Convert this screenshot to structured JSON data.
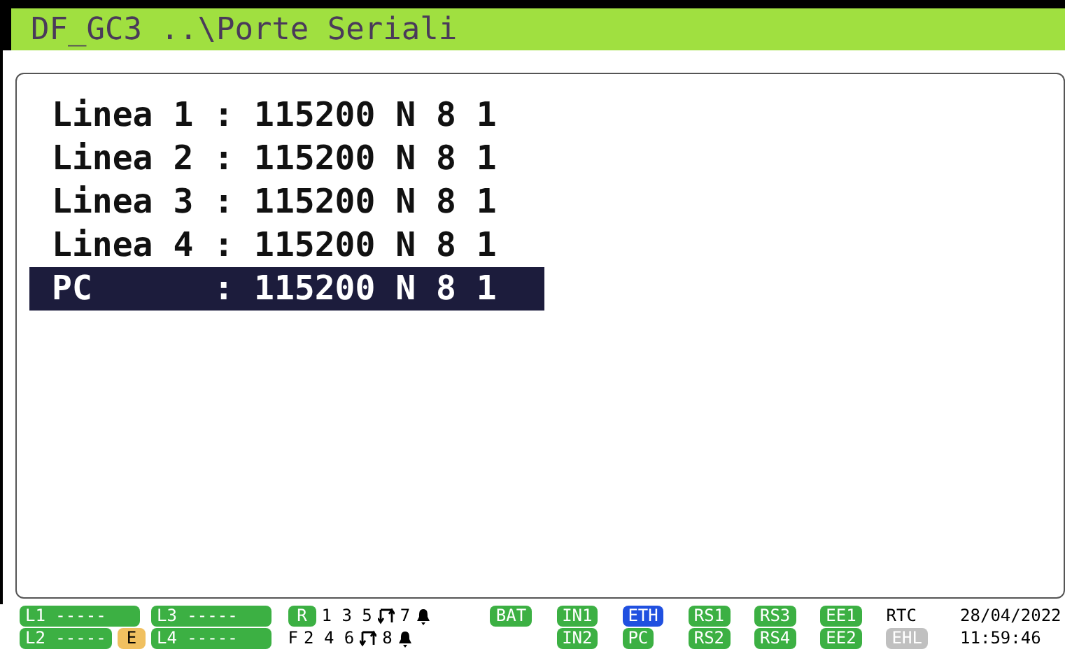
{
  "window": {
    "title": "DF_GC3 ..\\Porte Seriali"
  },
  "lines": [
    {
      "text": "Linea 1 : 115200 N 8 1",
      "selected": false
    },
    {
      "text": "Linea 2 : 115200 N 8 1",
      "selected": false
    },
    {
      "text": "Linea 3 : 115200 N 8 1",
      "selected": false
    },
    {
      "text": "Linea 4 : 115200 N 8 1",
      "selected": false
    },
    {
      "text": "PC      : 115200 N 8 1",
      "selected": true
    }
  ],
  "status_bar": {
    "columns": [
      {
        "rows": [
          [
            {
              "kind": "wide",
              "text": "L1 -----",
              "color": "#3cb043"
            }
          ],
          [
            {
              "kind": "wide",
              "text": "L2 -----",
              "color": "#3cb043"
            },
            {
              "kind": "badge",
              "text": "E",
              "color": "#f0c060"
            }
          ]
        ]
      },
      {
        "rows": [
          [
            {
              "kind": "wide",
              "text": "L3 -----",
              "color": "#3cb043"
            }
          ],
          [
            {
              "kind": "wide",
              "text": "L4 -----",
              "color": "#3cb043"
            }
          ]
        ]
      },
      {
        "rows": [
          [
            {
              "kind": "badge",
              "text": "R",
              "color": "#3cb043"
            },
            {
              "kind": "text",
              "text": "1 3 5"
            },
            {
              "kind": "swap"
            },
            {
              "kind": "text",
              "text": "7"
            },
            {
              "kind": "bell"
            }
          ],
          [
            {
              "kind": "text",
              "text": "F"
            },
            {
              "kind": "text",
              "text": "2 4 6"
            },
            {
              "kind": "swap"
            },
            {
              "kind": "text",
              "text": "8"
            },
            {
              "kind": "bell"
            }
          ]
        ]
      },
      {
        "rows": [
          [
            {
              "kind": "badge",
              "text": "BAT",
              "color": "#3cb043"
            }
          ],
          []
        ]
      },
      {
        "rows": [
          [
            {
              "kind": "badge",
              "text": "IN1",
              "color": "#3cb043"
            }
          ],
          [
            {
              "kind": "badge",
              "text": "IN2",
              "color": "#3cb043"
            }
          ]
        ]
      },
      {
        "rows": [
          [
            {
              "kind": "badge",
              "text": "ETH",
              "color": "#2050e0"
            }
          ],
          [
            {
              "kind": "badge",
              "text": "PC",
              "color": "#3cb043"
            }
          ]
        ]
      },
      {
        "rows": [
          [
            {
              "kind": "badge",
              "text": "RS1",
              "color": "#3cb043"
            }
          ],
          [
            {
              "kind": "badge",
              "text": "RS2",
              "color": "#3cb043"
            }
          ]
        ]
      },
      {
        "rows": [
          [
            {
              "kind": "badge",
              "text": "RS3",
              "color": "#3cb043"
            }
          ],
          [
            {
              "kind": "badge",
              "text": "RS4",
              "color": "#3cb043"
            }
          ]
        ]
      },
      {
        "rows": [
          [
            {
              "kind": "badge",
              "text": "EE1",
              "color": "#3cb043"
            }
          ],
          [
            {
              "kind": "badge",
              "text": "EE2",
              "color": "#3cb043"
            }
          ]
        ]
      },
      {
        "rows": [
          [
            {
              "kind": "text",
              "text": "RTC"
            }
          ],
          [
            {
              "kind": "badge",
              "text": "EHL",
              "color": "#c0c0c0"
            }
          ]
        ]
      },
      {
        "rows": [
          [
            {
              "kind": "text",
              "text": "28/04/2022"
            }
          ],
          [
            {
              "kind": "text",
              "text": "11:59:46"
            }
          ]
        ]
      }
    ]
  }
}
